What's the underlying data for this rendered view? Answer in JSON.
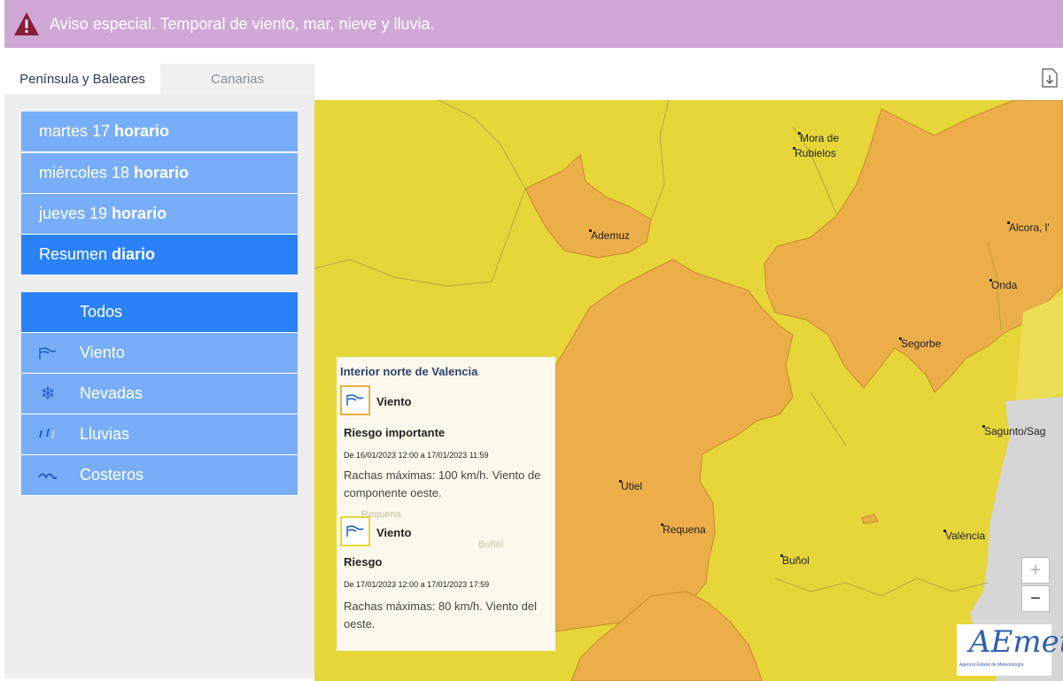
{
  "banner": {
    "text": "Aviso especial. Temporal de viento, mar, nieve y lluvia."
  },
  "tabs": [
    {
      "label": "Península y Baleares"
    },
    {
      "label": "Canarias"
    }
  ],
  "days": [
    {
      "prefix": "martes 17 ",
      "bold": "horario"
    },
    {
      "prefix": "miércoles 18 ",
      "bold": "horario"
    },
    {
      "prefix": "jueves 19 ",
      "bold": "horario"
    },
    {
      "prefix": "Resumen ",
      "bold": "diario"
    }
  ],
  "filters": [
    {
      "label": "Todos",
      "icon": "none"
    },
    {
      "label": "Viento",
      "icon": "wind-icon"
    },
    {
      "label": "Nevadas",
      "icon": "snowflake-icon"
    },
    {
      "label": "Lluvias",
      "icon": "rain-icon"
    },
    {
      "label": "Costeros",
      "icon": "waves-icon"
    }
  ],
  "map": {
    "cities": [
      {
        "name": "Mora de"
      },
      {
        "name": "Rubielos"
      },
      {
        "name": "Ademuz"
      },
      {
        "name": "Alcora, l'"
      },
      {
        "name": "Onda"
      },
      {
        "name": "Segorbe"
      },
      {
        "name": "Sagunto/Sag"
      },
      {
        "name": "Utiel"
      },
      {
        "name": "Requena"
      },
      {
        "name": "Buñol"
      },
      {
        "name": "València"
      }
    ],
    "faded_labels": {
      "requena": "Requena",
      "bunol": "Buñol"
    },
    "colors": {
      "yellow": "#e6d63a",
      "orange": "#ecae49",
      "sea": "#d6d6d6",
      "popup_orange_border": "#ecae49",
      "popup_yellow_border": "#e6d63a"
    }
  },
  "popup": {
    "title": "Interior norte de Valencia",
    "warnings": [
      {
        "type": "Viento",
        "level": "Riesgo importante",
        "dates": "De 16/01/2023 12:00 a 17/01/2023 11:59",
        "description": "Rachas máximas: 100 km/h. Viento de componente oeste."
      },
      {
        "type": "Viento",
        "level": "Riesgo",
        "dates": "De 17/01/2023 12:00 a 17/01/2023 17:59",
        "description": "Rachas máximas: 80 km/h. Viento del oeste."
      }
    ]
  },
  "zoom": {
    "in": "+",
    "out": "−"
  },
  "logo": {
    "text": "AEmet",
    "subtitle": "Agencia Estatal de Meteorología"
  }
}
